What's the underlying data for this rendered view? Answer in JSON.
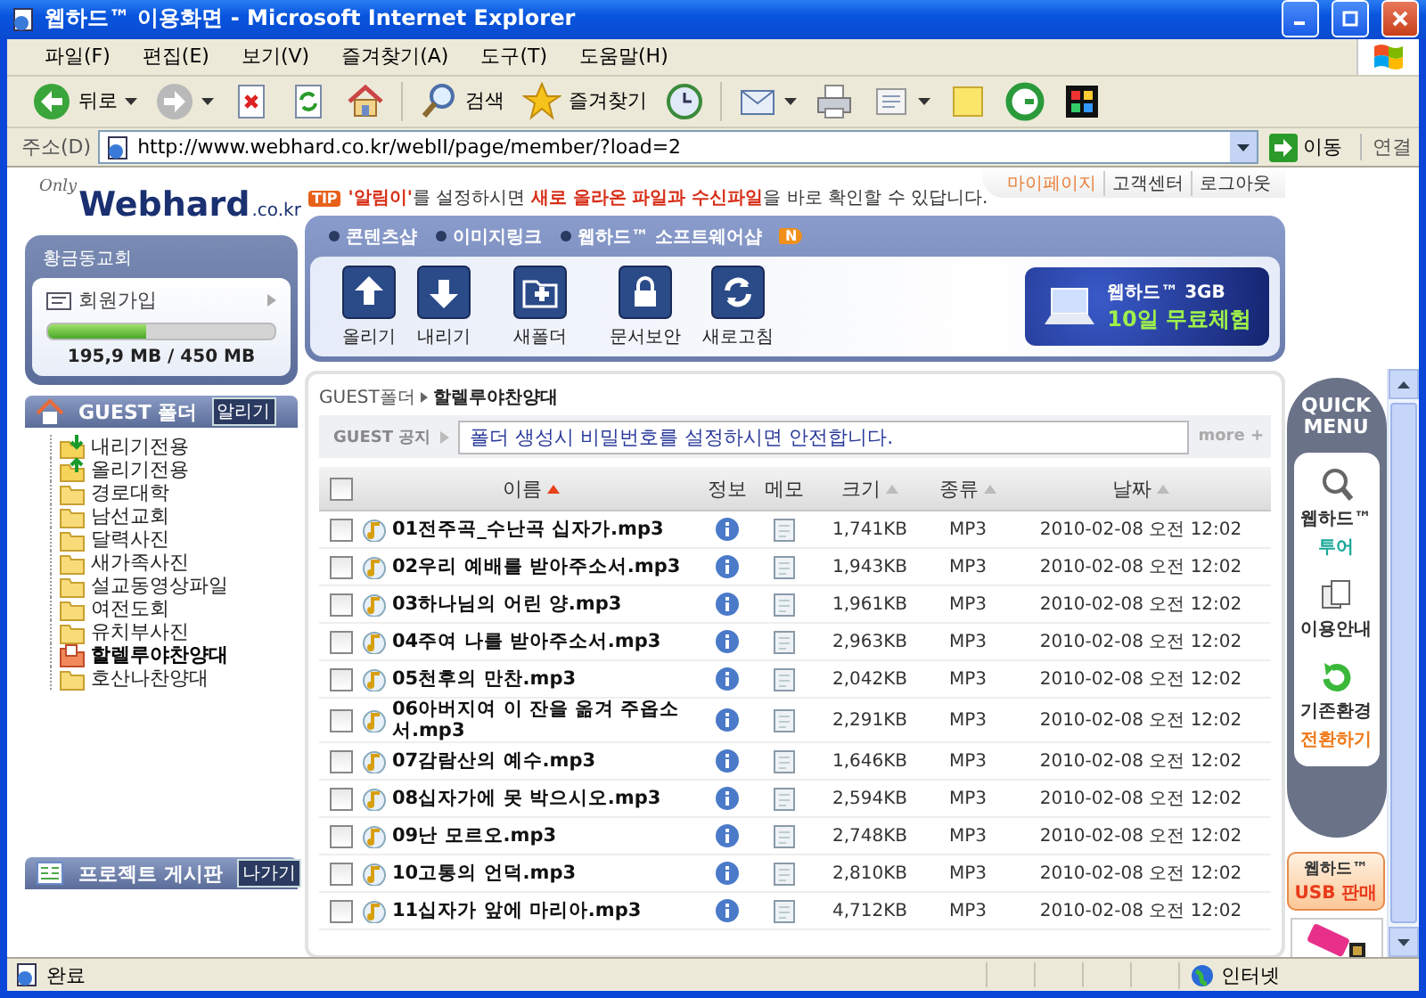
{
  "window": {
    "title": "웹하드™ 이용화면 - Microsoft Internet Explorer"
  },
  "menu_bar": [
    "파일(F)",
    "편집(E)",
    "보기(V)",
    "즐겨찾기(A)",
    "도구(T)",
    "도움말(H)"
  ],
  "toolbar": [
    {
      "kind": "back",
      "label": "뒤로",
      "dropdown": true
    },
    {
      "kind": "forward",
      "dropdown": true
    },
    {
      "kind": "stop",
      "dropdown": false
    },
    {
      "kind": "refresh",
      "dropdown": false
    },
    {
      "kind": "home",
      "dropdown": false
    },
    {
      "kind": "search",
      "label": "검색",
      "dropdown": false
    },
    {
      "kind": "favorites",
      "label": "즐겨찾기",
      "dropdown": false
    },
    {
      "kind": "history",
      "dropdown": false
    },
    {
      "kind": "mail",
      "dropdown": true
    },
    {
      "kind": "print",
      "dropdown": false
    },
    {
      "kind": "edit",
      "dropdown": true
    },
    {
      "kind": "note",
      "dropdown": false
    },
    {
      "kind": "ring",
      "dropdown": false
    },
    {
      "kind": "app",
      "dropdown": false
    }
  ],
  "address_bar": {
    "label": "주소(D)",
    "url": "http://www.webhard.co.kr/webII/page/member/?load=2",
    "go": "이동",
    "links": "연결"
  },
  "logo": {
    "tag": "Only",
    "name": "Webhard",
    "domain": ".co.kr"
  },
  "account": {
    "name": "황금동교회",
    "join": "회원가입",
    "level": 0.43,
    "usage": "195,9 MB / 450 MB"
  },
  "folder_panel": {
    "title": "GUEST 폴더",
    "badge": "알리기",
    "folders": [
      {
        "name": "내리기전용",
        "kind": "download",
        "selected": false
      },
      {
        "name": "올리기전용",
        "kind": "upload",
        "selected": false
      },
      {
        "name": "경로대학",
        "kind": "folder",
        "selected": false
      },
      {
        "name": "남선교회",
        "kind": "folder",
        "selected": false
      },
      {
        "name": "달력사진",
        "kind": "folder",
        "selected": false
      },
      {
        "name": "새가족사진",
        "kind": "folder",
        "selected": false
      },
      {
        "name": "설교동영상파일",
        "kind": "folder",
        "selected": false
      },
      {
        "name": "여전도회",
        "kind": "folder",
        "selected": false
      },
      {
        "name": "유치부사진",
        "kind": "folder",
        "selected": false
      },
      {
        "name": "할렐루야찬양대",
        "kind": "folder",
        "selected": true
      },
      {
        "name": "호산나찬양대",
        "kind": "folder",
        "selected": false
      }
    ]
  },
  "project_panel": {
    "title": "프로젝트 게시판",
    "badge": "나가기"
  },
  "tip": {
    "badge": "TIP",
    "text": "**'알림이'**를 설정하시면 **새로 올라온 파일과 수신파일**을 바로 확인할 수 있답니다."
  },
  "top_links": [
    {
      "label": "마이페이지",
      "selected": true
    },
    {
      "label": "고객센터",
      "selected": false
    },
    {
      "label": "로그아웃",
      "selected": false
    }
  ],
  "shop_links": [
    "콘텐츠샵",
    "이미지링크",
    "웹하드™ 소프트웨어샵"
  ],
  "shop_new_badge": "N",
  "actions": [
    {
      "kind": "upload",
      "label": "올리기"
    },
    {
      "kind": "download",
      "label": "내리기"
    },
    {
      "kind": "new_folder",
      "label": "새폴더"
    },
    {
      "kind": "lock",
      "label": "문서보안"
    },
    {
      "kind": "refresh",
      "label": "새로고침"
    }
  ],
  "promo": {
    "line1": "웹하드™ 3GB",
    "line2": "10일 무료체험"
  },
  "breadcrumb": [
    "GUEST폴더",
    "할렐루야찬양대"
  ],
  "notice": {
    "label": "GUEST 공지",
    "text": "폴더 생성시 비밀번호를 설정하시면 안전합니다.",
    "more": "more +"
  },
  "table": {
    "select_all": false,
    "columns": [
      {
        "label": "이름",
        "kind": "sortable",
        "sorted": true
      },
      {
        "label": "정보",
        "kind": "plain",
        "sorted": false
      },
      {
        "label": "메모",
        "kind": "plain",
        "sorted": false
      },
      {
        "label": "크기",
        "kind": "sortable",
        "sorted": false
      },
      {
        "label": "종류",
        "kind": "sortable",
        "sorted": false
      },
      {
        "label": "날짜",
        "kind": "sortable",
        "sorted": false
      }
    ],
    "rows": [
      {
        "name": "01전주곡_수난곡 십자가.mp3",
        "size": "1,741KB",
        "type": "MP3",
        "date": "2010-02-08 오전 12:02",
        "checked": false
      },
      {
        "name": "02우리 예배를 받아주소서.mp3",
        "size": "1,943KB",
        "type": "MP3",
        "date": "2010-02-08 오전 12:02",
        "checked": false
      },
      {
        "name": "03하나님의 어린 양.mp3",
        "size": "1,961KB",
        "type": "MP3",
        "date": "2010-02-08 오전 12:02",
        "checked": false
      },
      {
        "name": "04주여 나를 받아주소서.mp3",
        "size": "2,963KB",
        "type": "MP3",
        "date": "2010-02-08 오전 12:02",
        "checked": false
      },
      {
        "name": "05천후의 만찬.mp3",
        "size": "2,042KB",
        "type": "MP3",
        "date": "2010-02-08 오전 12:02",
        "checked": false
      },
      {
        "name": "06아버지여 이 잔을 옮겨 주옵소서.mp3",
        "size": "2,291KB",
        "type": "MP3",
        "date": "2010-02-08 오전 12:02",
        "checked": false
      },
      {
        "name": "07감람산의 예수.mp3",
        "size": "1,646KB",
        "type": "MP3",
        "date": "2010-02-08 오전 12:02",
        "checked": false
      },
      {
        "name": "08십자가에 못 박으시오.mp3",
        "size": "2,594KB",
        "type": "MP3",
        "date": "2010-02-08 오전 12:02",
        "checked": false
      },
      {
        "name": "09난 모르오.mp3",
        "size": "2,748KB",
        "type": "MP3",
        "date": "2010-02-08 오전 12:02",
        "checked": false
      },
      {
        "name": "10고통의 언덕.mp3",
        "size": "2,810KB",
        "type": "MP3",
        "date": "2010-02-08 오전 12:02",
        "checked": false
      },
      {
        "name": "11십자가 앞에 마리아.mp3",
        "size": "4,712KB",
        "type": "MP3",
        "date": "2010-02-08 오전 12:02",
        "checked": false
      }
    ]
  },
  "quick_menu": {
    "title": "QUICK MENU",
    "items": [
      {
        "kind": "search",
        "label": "웹하드™",
        "sub": "투어"
      },
      {
        "kind": "guide",
        "label": "이용안내"
      },
      {
        "kind": "switch",
        "label": "기존환경",
        "sub": "전환하기"
      }
    ],
    "usb": {
      "line1": "웹하드™",
      "line2": "USB 판매"
    }
  },
  "status_bar": {
    "text": "완료",
    "zone": "인터넷"
  }
}
